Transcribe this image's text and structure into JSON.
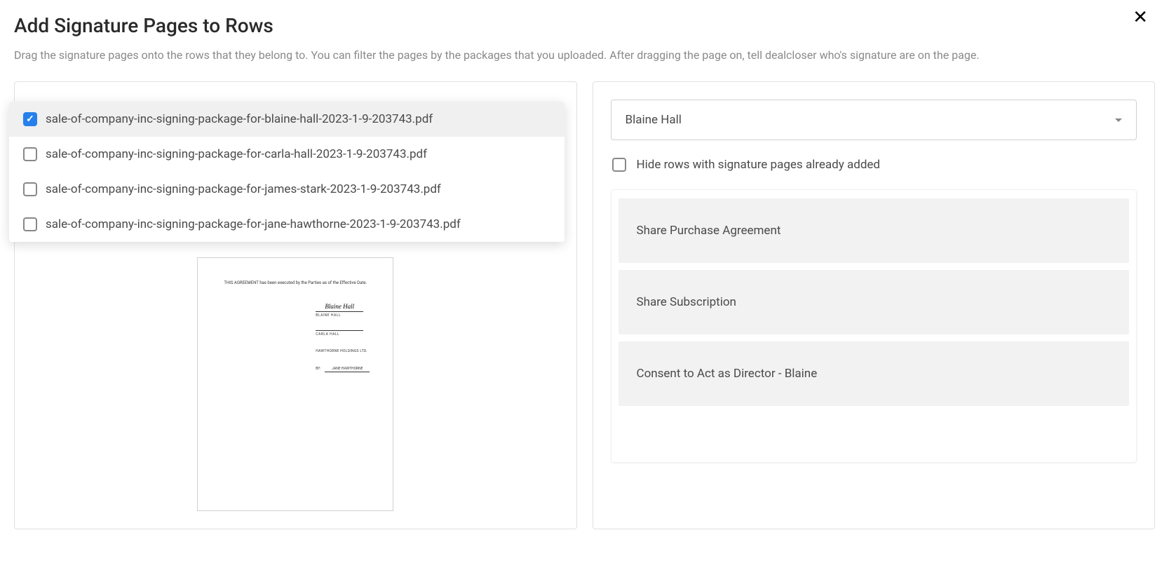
{
  "header": {
    "title": "Add Signature Pages to Rows",
    "subtitle": "Drag the signature pages onto the rows that they belong to. You can filter the pages by the packages that you uploaded. After dragging the page on, tell dealcloser who's signature are on the page."
  },
  "packages": [
    {
      "label": "sale-of-company-inc-signing-package-for-blaine-hall-2023-1-9-203743.pdf",
      "checked": true
    },
    {
      "label": "sale-of-company-inc-signing-package-for-carla-hall-2023-1-9-203743.pdf",
      "checked": false
    },
    {
      "label": "sale-of-company-inc-signing-package-for-james-stark-2023-1-9-203743.pdf",
      "checked": false
    },
    {
      "label": "sale-of-company-inc-signing-package-for-jane-hawthorne-2023-1-9-203743.pdf",
      "checked": false
    }
  ],
  "preview": {
    "topText": "THIS AGREEMENT has been executed by the Parties as of the Effective Date.",
    "sig1Script": "Blaine Hall",
    "sig1Name": "BLAINE HALL",
    "sig2Name": "CARLA HALL",
    "company": "HAWTHORNE HOLDINGS LTD.",
    "byLabel": "BY:",
    "byName": "JANE HAWTHORNE"
  },
  "selector": {
    "selected": "Blaine Hall"
  },
  "hideRows": {
    "label": "Hide rows with signature pages already added",
    "checked": false
  },
  "rows": [
    {
      "label": "Share Purchase Agreement"
    },
    {
      "label": "Share Subscription"
    },
    {
      "label": "Consent to Act as Director - Blaine"
    }
  ]
}
